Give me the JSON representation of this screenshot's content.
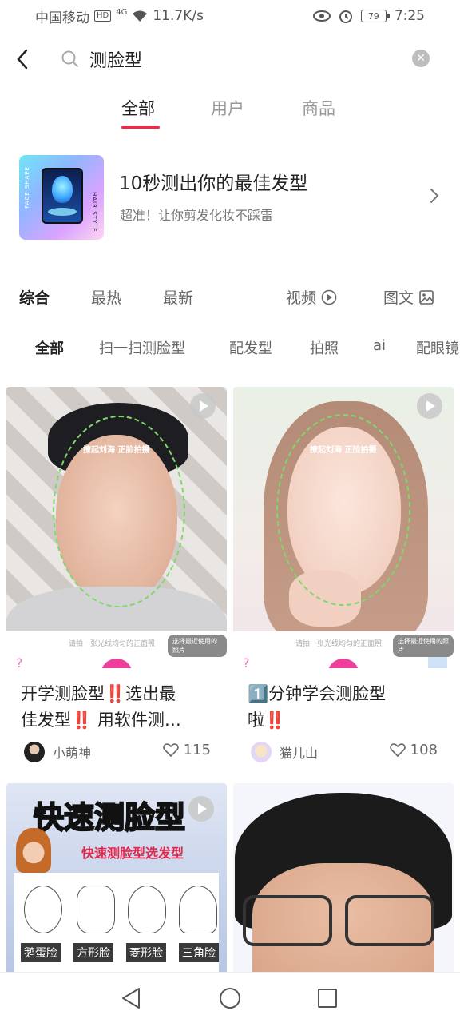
{
  "status_bar": {
    "carrier": "中国移动",
    "hd": "HD",
    "signal": "4G",
    "speed": "11.7K/s",
    "battery": "79",
    "time": "7:25"
  },
  "search": {
    "query": "测脸型"
  },
  "main_tabs": [
    {
      "label": "全部",
      "active": true
    },
    {
      "label": "用户",
      "active": false
    },
    {
      "label": "商品",
      "active": false
    }
  ],
  "promo": {
    "title": "10秒测出你的最佳发型",
    "subtitle": "超准！让你剪发化妆不踩雷",
    "thumb_left_text": "FACE SHAPE",
    "thumb_right_text": "HAIR STYLE"
  },
  "sort_options": [
    {
      "label": "综合",
      "active": true
    },
    {
      "label": "最热",
      "active": false
    },
    {
      "label": "最新",
      "active": false
    },
    {
      "label": "视频",
      "active": false
    },
    {
      "label": "图文",
      "active": false
    }
  ],
  "filter_chips": [
    {
      "label": "全部",
      "active": true
    },
    {
      "label": "扫一扫测脸型",
      "active": false
    },
    {
      "label": "配发型",
      "active": false
    },
    {
      "label": "拍照",
      "active": false
    },
    {
      "label": "ai",
      "active": false
    },
    {
      "label": "配眼镜",
      "active": false
    }
  ],
  "feed": [
    {
      "overlay": "撩起刘海 正脸拍摄",
      "hint": "请拍一张光线均匀的正面照",
      "pill": "选择最近使用的照片",
      "title_line1": "开学测脸型‼️选出最",
      "title_line2": "佳发型‼️ 用软件测…",
      "user": "小萌神",
      "likes": "115"
    },
    {
      "overlay": "撩起刘海 正脸拍摄",
      "hint": "请拍一张光线均匀的正面照",
      "pill": "选择最近使用的照片",
      "title_line1": "1️⃣分钟学会测脸型",
      "title_line2": "啦‼️",
      "user": "猫儿山",
      "likes": "108"
    },
    {
      "banner_title": "快速测脸型",
      "banner_sub": "快速测脸型选发型",
      "shapes": [
        "鹅蛋脸",
        "方形脸",
        "菱形脸",
        "三角脸"
      ]
    },
    {}
  ],
  "colors": {
    "accent": "#ff2442",
    "face_outline": "#7fd86a"
  }
}
